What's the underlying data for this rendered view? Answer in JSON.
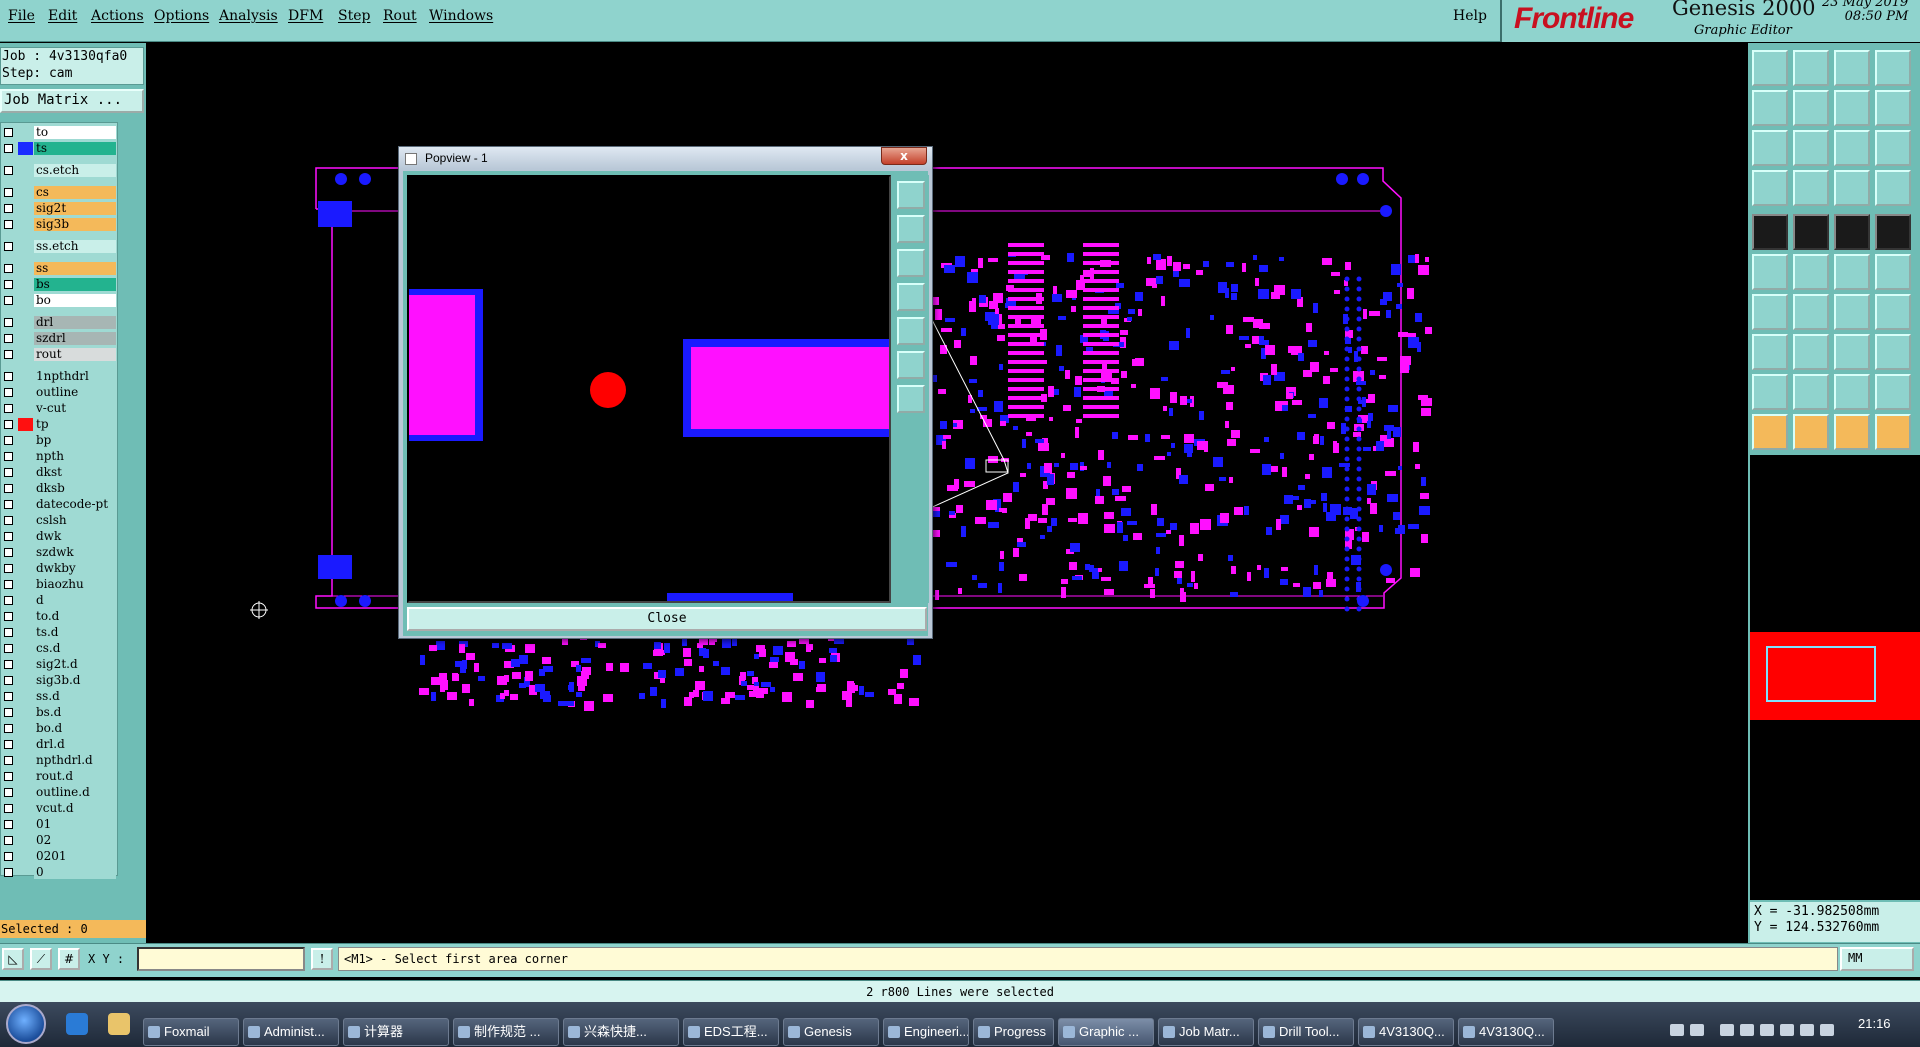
{
  "menu": {
    "items": [
      "File",
      "Edit",
      "Actions",
      "Options",
      "Analysis",
      "DFM",
      "Step",
      "Rout",
      "Windows"
    ],
    "help": "Help"
  },
  "brand": {
    "logo": "Frontline",
    "title": "Genesis 2000",
    "subtitle": "Graphic Editor",
    "date": "23 May 2019",
    "time": "08:50 PM"
  },
  "job": {
    "job_line": "Job : 4v3130qfa0",
    "step_line": "Step: cam",
    "matrix_button": "Job Matrix ..."
  },
  "layers": [
    {
      "name": "to",
      "color": "#ffffff",
      "sw": ""
    },
    {
      "name": "ts",
      "color": "#23b38f",
      "sw": "#1a2cff"
    },
    {
      "name": "cs.etch",
      "color": "#c9efe9",
      "sw": ""
    },
    {
      "name": "cs",
      "color": "#f4b95a",
      "sw": ""
    },
    {
      "name": "sig2t",
      "color": "#f4b95a",
      "sw": ""
    },
    {
      "name": "sig3b",
      "color": "#f4b95a",
      "sw": ""
    },
    {
      "name": "ss.etch",
      "color": "#c9efe9",
      "sw": ""
    },
    {
      "name": "ss",
      "color": "#f4b95a",
      "sw": ""
    },
    {
      "name": "bs",
      "color": "#23b38f",
      "sw": ""
    },
    {
      "name": "bo",
      "color": "#ffffff",
      "sw": ""
    },
    {
      "name": "drl",
      "color": "#a7b6b4",
      "sw": ""
    },
    {
      "name": "szdrl",
      "color": "#a7b6b4",
      "sw": ""
    },
    {
      "name": "rout",
      "color": "#d8dcdc",
      "sw": ""
    },
    {
      "name": "1npthdrl",
      "color": "#9fdad3",
      "sw": ""
    },
    {
      "name": "outline",
      "color": "#9fdad3",
      "sw": ""
    },
    {
      "name": "v-cut",
      "color": "#9fdad3",
      "sw": ""
    },
    {
      "name": "tp",
      "color": "#9fdad3",
      "sw": "#ff1010"
    },
    {
      "name": "bp",
      "color": "#9fdad3",
      "sw": ""
    },
    {
      "name": "npth",
      "color": "#9fdad3",
      "sw": ""
    },
    {
      "name": "dkst",
      "color": "#9fdad3",
      "sw": ""
    },
    {
      "name": "dksb",
      "color": "#9fdad3",
      "sw": ""
    },
    {
      "name": "datecode-pt",
      "color": "#9fdad3",
      "sw": ""
    },
    {
      "name": "cslsh",
      "color": "#9fdad3",
      "sw": ""
    },
    {
      "name": "dwk",
      "color": "#9fdad3",
      "sw": ""
    },
    {
      "name": "szdwk",
      "color": "#9fdad3",
      "sw": ""
    },
    {
      "name": "dwkby",
      "color": "#9fdad3",
      "sw": ""
    },
    {
      "name": "biaozhu",
      "color": "#9fdad3",
      "sw": ""
    },
    {
      "name": "d",
      "color": "#9fdad3",
      "sw": ""
    },
    {
      "name": "to.d",
      "color": "#9fdad3",
      "sw": ""
    },
    {
      "name": "ts.d",
      "color": "#9fdad3",
      "sw": ""
    },
    {
      "name": "cs.d",
      "color": "#9fdad3",
      "sw": ""
    },
    {
      "name": "sig2t.d",
      "color": "#9fdad3",
      "sw": ""
    },
    {
      "name": "sig3b.d",
      "color": "#9fdad3",
      "sw": ""
    },
    {
      "name": "ss.d",
      "color": "#9fdad3",
      "sw": ""
    },
    {
      "name": "bs.d",
      "color": "#9fdad3",
      "sw": ""
    },
    {
      "name": "bo.d",
      "color": "#9fdad3",
      "sw": ""
    },
    {
      "name": "drl.d",
      "color": "#9fdad3",
      "sw": ""
    },
    {
      "name": "npthdrl.d",
      "color": "#9fdad3",
      "sw": ""
    },
    {
      "name": "rout.d",
      "color": "#9fdad3",
      "sw": ""
    },
    {
      "name": "outline.d",
      "color": "#9fdad3",
      "sw": ""
    },
    {
      "name": "vcut.d",
      "color": "#9fdad3",
      "sw": ""
    },
    {
      "name": "01",
      "color": "#9fdad3",
      "sw": ""
    },
    {
      "name": "02",
      "color": "#9fdad3",
      "sw": ""
    },
    {
      "name": "0201",
      "color": "#9fdad3",
      "sw": ""
    },
    {
      "name": "0",
      "color": "#9fdad3",
      "sw": ""
    }
  ],
  "selected_count": "Selected : 0",
  "popview": {
    "title": "Popview - 1",
    "close_x": "x",
    "close_button": "Close"
  },
  "coords": {
    "x": "X = -31.982508mm",
    "y": "Y = 124.532760mm"
  },
  "cmd": {
    "xy_label": "X Y :",
    "xy_value": "",
    "prompt": "<M1> - Select first area corner",
    "units": "MM"
  },
  "status": "2 r800 Lines were selected",
  "taskbar": {
    "tasks": [
      "Foxmail",
      "Administ...",
      "计算器",
      "制作规范 ...",
      "兴森快捷...",
      "EDS工程...",
      "Genesis",
      "Engineeri...",
      "Progress",
      "Graphic ...",
      "Job Matr...",
      "Drill Tool...",
      "4V3130Q...",
      "4V3130Q..."
    ],
    "clock": "21:16"
  },
  "colors": {
    "panel": "#6fbdb5",
    "menubar": "#8fd3cd",
    "pad_magenta": "#ff10ff",
    "pad_blue": "#1a1aff",
    "feature_red": "#ff0000"
  }
}
